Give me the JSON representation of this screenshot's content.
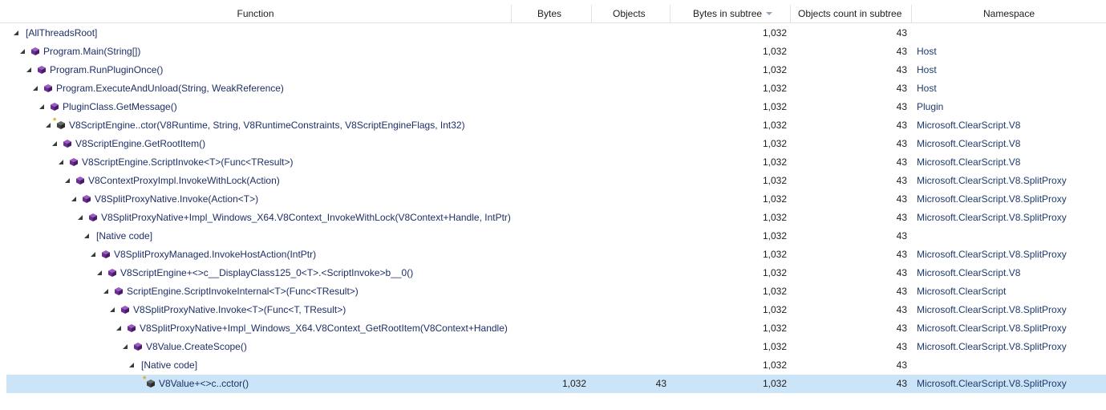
{
  "columns": {
    "function": "Function",
    "bytes": "Bytes",
    "objects": "Objects",
    "bytes_in_subtree": "Bytes in subtree",
    "objects_count_in_subtree": "Objects count in subtree",
    "namespace": "Namespace"
  },
  "sort_column": "bytes_in_subtree",
  "rows": [
    {
      "name": "[AllThreadsRoot]",
      "bytes": "",
      "objects": "",
      "bytes_subtree": "1,032",
      "objects_subtree": "43",
      "namespace": "",
      "icon": "none",
      "depth": 0
    },
    {
      "name": "Program.Main(String[])",
      "bytes": "",
      "objects": "",
      "bytes_subtree": "1,032",
      "objects_subtree": "43",
      "namespace": "Host",
      "icon": "method-icon",
      "depth": 1
    },
    {
      "name": "Program.RunPluginOnce()",
      "bytes": "",
      "objects": "",
      "bytes_subtree": "1,032",
      "objects_subtree": "43",
      "namespace": "Host",
      "icon": "method-icon",
      "depth": 2
    },
    {
      "name": "Program.ExecuteAndUnload(String, WeakReference)",
      "bytes": "",
      "objects": "",
      "bytes_subtree": "1,032",
      "objects_subtree": "43",
      "namespace": "Host",
      "icon": "method-icon",
      "depth": 3
    },
    {
      "name": "PluginClass.GetMessage()",
      "bytes": "",
      "objects": "",
      "bytes_subtree": "1,032",
      "objects_subtree": "43",
      "namespace": "Plugin",
      "icon": "method-icon",
      "depth": 4
    },
    {
      "name": "V8ScriptEngine..ctor(V8Runtime, String, V8RuntimeConstraints, V8ScriptEngineFlags, Int32)",
      "bytes": "",
      "objects": "",
      "bytes_subtree": "1,032",
      "objects_subtree": "43",
      "namespace": "Microsoft.ClearScript.V8",
      "icon": "constructor-icon",
      "depth": 5
    },
    {
      "name": "V8ScriptEngine.GetRootItem()",
      "bytes": "",
      "objects": "",
      "bytes_subtree": "1,032",
      "objects_subtree": "43",
      "namespace": "Microsoft.ClearScript.V8",
      "icon": "method-icon",
      "depth": 6
    },
    {
      "name": "V8ScriptEngine.ScriptInvoke<T>(Func<TResult>)",
      "bytes": "",
      "objects": "",
      "bytes_subtree": "1,032",
      "objects_subtree": "43",
      "namespace": "Microsoft.ClearScript.V8",
      "icon": "method-icon",
      "depth": 7
    },
    {
      "name": "V8ContextProxyImpl.InvokeWithLock(Action)",
      "bytes": "",
      "objects": "",
      "bytes_subtree": "1,032",
      "objects_subtree": "43",
      "namespace": "Microsoft.ClearScript.V8.SplitProxy",
      "icon": "method-icon",
      "depth": 8
    },
    {
      "name": "V8SplitProxyNative.Invoke(Action<T>)",
      "bytes": "",
      "objects": "",
      "bytes_subtree": "1,032",
      "objects_subtree": "43",
      "namespace": "Microsoft.ClearScript.V8.SplitProxy",
      "icon": "method-icon",
      "depth": 9
    },
    {
      "name": "V8SplitProxyNative+Impl_Windows_X64.V8Context_InvokeWithLock(V8Context+Handle, IntPtr)",
      "bytes": "",
      "objects": "",
      "bytes_subtree": "1,032",
      "objects_subtree": "43",
      "namespace": "Microsoft.ClearScript.V8.SplitProxy",
      "icon": "method-icon",
      "depth": 10
    },
    {
      "name": "[Native code]",
      "bytes": "",
      "objects": "",
      "bytes_subtree": "1,032",
      "objects_subtree": "43",
      "namespace": "",
      "icon": "none",
      "depth": 11
    },
    {
      "name": "V8SplitProxyManaged.InvokeHostAction(IntPtr)",
      "bytes": "",
      "objects": "",
      "bytes_subtree": "1,032",
      "objects_subtree": "43",
      "namespace": "Microsoft.ClearScript.V8.SplitProxy",
      "icon": "method-icon",
      "depth": 12
    },
    {
      "name": "V8ScriptEngine+<>c__DisplayClass125_0<T>.<ScriptInvoke>b__0()",
      "bytes": "",
      "objects": "",
      "bytes_subtree": "1,032",
      "objects_subtree": "43",
      "namespace": "Microsoft.ClearScript.V8",
      "icon": "method-icon",
      "depth": 13
    },
    {
      "name": "ScriptEngine.ScriptInvokeInternal<T>(Func<TResult>)",
      "bytes": "",
      "objects": "",
      "bytes_subtree": "1,032",
      "objects_subtree": "43",
      "namespace": "Microsoft.ClearScript",
      "icon": "method-icon",
      "depth": 14
    },
    {
      "name": "V8SplitProxyNative.Invoke<T>(Func<T, TResult>)",
      "bytes": "",
      "objects": "",
      "bytes_subtree": "1,032",
      "objects_subtree": "43",
      "namespace": "Microsoft.ClearScript.V8.SplitProxy",
      "icon": "method-icon",
      "depth": 15
    },
    {
      "name": "V8SplitProxyNative+Impl_Windows_X64.V8Context_GetRootItem(V8Context+Handle)",
      "bytes": "",
      "objects": "",
      "bytes_subtree": "1,032",
      "objects_subtree": "43",
      "namespace": "Microsoft.ClearScript.V8.SplitProxy",
      "icon": "method-icon",
      "depth": 16
    },
    {
      "name": "V8Value.CreateScope()",
      "bytes": "",
      "objects": "",
      "bytes_subtree": "1,032",
      "objects_subtree": "43",
      "namespace": "Microsoft.ClearScript.V8.SplitProxy",
      "icon": "method-icon",
      "depth": 17
    },
    {
      "name": "[Native code]",
      "bytes": "",
      "objects": "",
      "bytes_subtree": "1,032",
      "objects_subtree": "43",
      "namespace": "",
      "icon": "none",
      "depth": 18
    },
    {
      "name": "V8Value+<>c..cctor()",
      "bytes": "1,032",
      "objects": "43",
      "bytes_subtree": "1,032",
      "objects_subtree": "43",
      "namespace": "Microsoft.ClearScript.V8.SplitProxy",
      "icon": "constructor-icon",
      "depth": 19,
      "selected": true,
      "leaf": true
    }
  ],
  "colors": {
    "selection": "#cce4f7",
    "method_icon": "#6c2d91",
    "star": "#e8a21c",
    "header_border": "#e3e3e3"
  }
}
